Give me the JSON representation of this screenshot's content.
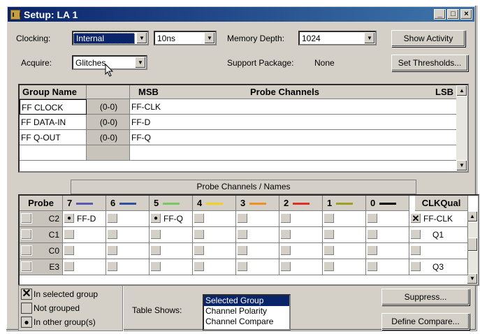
{
  "window": {
    "title": "Setup: LA 1",
    "min": "_",
    "max": "□",
    "close": "×"
  },
  "top": {
    "clocking_label": "Clocking:",
    "clocking_value": "Internal",
    "period_value": "10ns",
    "memdepth_label": "Memory Depth:",
    "memdepth_value": "1024",
    "show_activity": "Show Activity",
    "acquire_label": "Acquire:",
    "acquire_value": "Glitches",
    "support_label": "Support Package:",
    "support_value": "None",
    "set_thresholds": "Set Thresholds..."
  },
  "groups": {
    "headers": {
      "name": "Group Name",
      "msb": "MSB",
      "channels": "Probe Channels",
      "lsb": "LSB"
    },
    "rows": [
      {
        "name": "FF CLOCK",
        "range": "(0-0)",
        "channels": "FF-CLK"
      },
      {
        "name": "FF DATA-IN",
        "range": "(0-0)",
        "channels": "FF-D"
      },
      {
        "name": "FF Q-OUT",
        "range": "(0-0)",
        "channels": "FF-Q"
      }
    ]
  },
  "probes": {
    "caption": "Probe Channels / Names",
    "probe_header": "Probe",
    "clkqual_header": "CLKQual",
    "channel_headers": [
      "7",
      "6",
      "5",
      "4",
      "3",
      "2",
      "1",
      "0"
    ],
    "channel_colors": [
      "#5a5ab4",
      "#3050a0",
      "#7cc860",
      "#f0d020",
      "#f09020",
      "#e03020",
      "#a0a020",
      "#000000"
    ],
    "rows": [
      {
        "probe": "C2",
        "names": [
          "FF-D",
          "",
          "FF-Q",
          "",
          "",
          "",
          "",
          ""
        ],
        "clk": "FF-CLK"
      },
      {
        "probe": "C1",
        "names": [
          "",
          "",
          "",
          "",
          "",
          "",
          "",
          ""
        ],
        "clk": "Q1"
      },
      {
        "probe": "C0",
        "names": [
          "",
          "",
          "",
          "",
          "",
          "",
          "",
          ""
        ],
        "clk": ""
      },
      {
        "probe": "E3",
        "names": [
          "",
          "",
          "",
          "",
          "",
          "",
          "",
          ""
        ],
        "clk": "Q3"
      }
    ]
  },
  "legend": {
    "in_selected": "In selected group",
    "not_grouped": "Not grouped",
    "in_other": "In other group(s)"
  },
  "table_shows": {
    "label": "Table Shows:",
    "options": [
      "Selected Group",
      "Channel Polarity",
      "Channel Compare"
    ]
  },
  "buttons": {
    "suppress": "Suppress...",
    "define_compare": "Define Compare..."
  }
}
